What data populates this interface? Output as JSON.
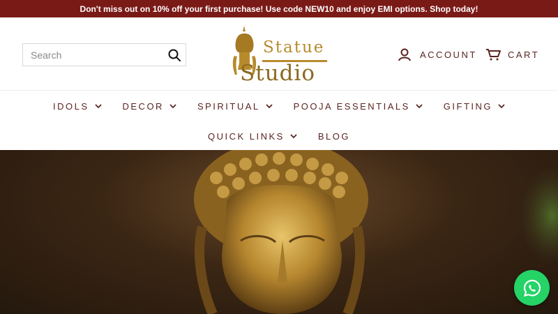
{
  "announcement": {
    "text": "Don't miss out on 10% off your first purchase! Use code NEW10 and enjoy EMI options. Shop today!"
  },
  "header": {
    "search": {
      "placeholder": "Search",
      "value": "",
      "icon": "search-icon"
    },
    "logo": {
      "line1": "Statue",
      "line2": "Studio"
    },
    "account_label": "ACCOUNT",
    "cart_label": "CART"
  },
  "nav": {
    "row1": [
      {
        "label": "IDOLS",
        "has_dropdown": true
      },
      {
        "label": "DECOR",
        "has_dropdown": true
      },
      {
        "label": "SPIRITUAL",
        "has_dropdown": true
      },
      {
        "label": "POOJA ESSENTIALS",
        "has_dropdown": true
      },
      {
        "label": "GIFTING",
        "has_dropdown": true
      }
    ],
    "row2": [
      {
        "label": "QUICK LINKS",
        "has_dropdown": true
      },
      {
        "label": "BLOG",
        "has_dropdown": false
      }
    ]
  },
  "colors": {
    "announcement_bg": "#7a1a17",
    "nav_text": "#5a2420",
    "logo_gold": "#b78a2c",
    "whatsapp_green": "#25d366"
  },
  "whatsapp": {
    "icon": "whatsapp-icon"
  }
}
